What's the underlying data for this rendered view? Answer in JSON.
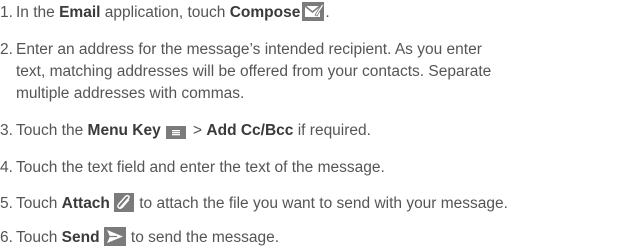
{
  "steps": [
    {
      "number": "1.",
      "lines": [
        {
          "t1": "In the ",
          "b1": "Email",
          "t2": " application, touch ",
          "b2": "Compose"
        }
      ],
      "icon": "compose-icon"
    },
    {
      "number": "2.",
      "lines": [
        "Enter an address for the message’s intended recipient. As you enter",
        "text, matching addresses will be offered from your contacts. Separate",
        "multiple addresses with commas."
      ]
    },
    {
      "number": "3.",
      "t1": "Touch the ",
      "b1": "Menu Key",
      "t2": " > ",
      "b2": "Add Cc/Bcc",
      "t3": " if required.",
      "icon": "menu-key-icon"
    },
    {
      "number": "4.",
      "text": "Touch the text field and enter the text of the message."
    },
    {
      "number": "5.",
      "t1": "Touch ",
      "b1": "Attach",
      "t2": " to attach the file you want to send with your message.",
      "icon": "attach-icon"
    },
    {
      "number": "6.",
      "t1": "Touch ",
      "b1": "Send",
      "t2": " to send the message.",
      "icon": "send-icon"
    }
  ],
  "colors": {
    "text": "#555555",
    "bold_text": "#3a3a3a",
    "icon_fill": "#7b7b7b"
  }
}
